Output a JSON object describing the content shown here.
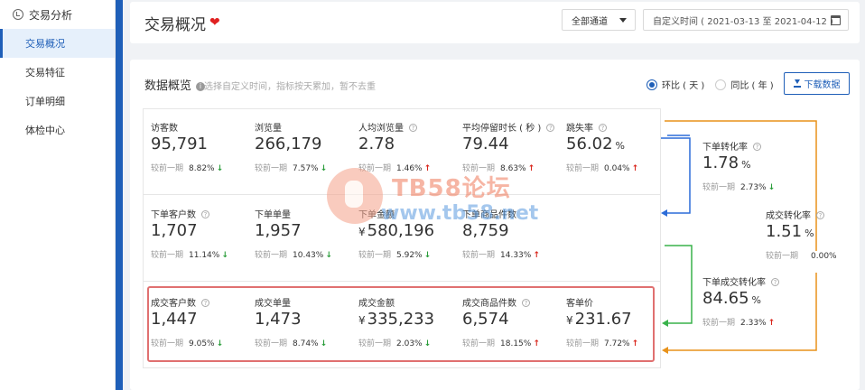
{
  "sidebar": {
    "header": "交易分析",
    "items": [
      {
        "label": "交易概况",
        "active": true
      },
      {
        "label": "交易特征",
        "active": false
      },
      {
        "label": "订单明细",
        "active": false
      },
      {
        "label": "体检中心",
        "active": false
      }
    ]
  },
  "header": {
    "title": "交易概况",
    "heart": "❤",
    "channel": "全部通道",
    "date_range": "自定义时间 ( 2021-03-13 至 2021-04-12 )"
  },
  "overview": {
    "title": "数据概览",
    "hint": "选择自定义时间，指标按天累加，暂不去重",
    "radio_day": "环比 ( 天 )",
    "radio_year": "同比 ( 年 )",
    "download": "下载数据",
    "compare_label": "较前一期",
    "row1": [
      {
        "label": "访客数",
        "value": "95,791",
        "change": "8.82%",
        "dir": "down",
        "help": false
      },
      {
        "label": "浏览量",
        "value": "266,179",
        "change": "7.57%",
        "dir": "down",
        "help": false
      },
      {
        "label": "人均浏览量",
        "value": "2.78",
        "change": "1.46%",
        "dir": "up",
        "help": true
      },
      {
        "label": "平均停留时长 ( 秒 )",
        "value": "79.44",
        "change": "8.63%",
        "dir": "up",
        "help": true
      },
      {
        "label": "跳失率",
        "value": "56.02",
        "unit": "%",
        "change": "0.04%",
        "dir": "up",
        "help": true
      }
    ],
    "row2": [
      {
        "label": "下单客户数",
        "value": "1,707",
        "change": "11.14%",
        "dir": "down",
        "help": true
      },
      {
        "label": "下单单量",
        "value": "1,957",
        "change": "10.43%",
        "dir": "down",
        "help": false
      },
      {
        "label": "下单金额",
        "value": "580,196",
        "currency": "¥",
        "change": "5.92%",
        "dir": "down",
        "help": false
      },
      {
        "label": "下单商品件数",
        "value": "8,759",
        "change": "14.33%",
        "dir": "up",
        "help": false
      }
    ],
    "row3": [
      {
        "label": "成交客户数",
        "value": "1,447",
        "change": "9.05%",
        "dir": "down",
        "help": true
      },
      {
        "label": "成交单量",
        "value": "1,473",
        "change": "8.74%",
        "dir": "down",
        "help": false
      },
      {
        "label": "成交金额",
        "value": "335,233",
        "currency": "¥",
        "change": "2.03%",
        "dir": "down",
        "help": false
      },
      {
        "label": "成交商品件数",
        "value": "6,574",
        "change": "18.15%",
        "dir": "up",
        "help": true
      },
      {
        "label": "客单价",
        "value": "231.67",
        "currency": "¥",
        "change": "7.72%",
        "dir": "up",
        "help": false
      }
    ],
    "funnel": [
      {
        "label": "下单转化率",
        "value": "1.78",
        "unit": "%",
        "change": "2.73%",
        "dir": "down"
      },
      {
        "label": "成交转化率",
        "value": "1.51",
        "unit": "%",
        "change": "0.00%",
        "dir": "none"
      },
      {
        "label": "下单成交转化率",
        "value": "84.65",
        "unit": "%",
        "change": "2.33%",
        "dir": "up"
      }
    ]
  },
  "watermark": {
    "line1": "TB58论坛",
    "line2": "www.tb58.net"
  },
  "colors": {
    "accent": "#1f5fb8",
    "up": "#d9261c",
    "down": "#2a9d3a",
    "highlight": "#e07070",
    "funnel_blue": "#2b6cd8",
    "funnel_green": "#38b24a",
    "funnel_orange": "#e8921a"
  }
}
